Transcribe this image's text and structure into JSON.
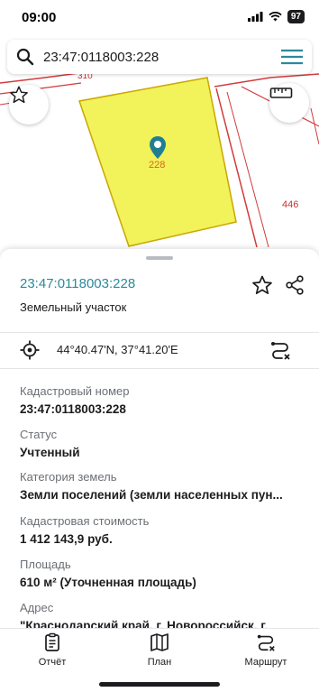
{
  "status_bar": {
    "time": "09:00",
    "battery": "97"
  },
  "search": {
    "query": "23:47:0118003:228"
  },
  "map": {
    "parcel_label": "228",
    "neighbor_label": "446",
    "partial_label": "310",
    "parcel_color": "#f2f25a",
    "boundary_color": "#d23b3b"
  },
  "card": {
    "title": "23:47:0118003:228",
    "subtitle": "Земельный участок",
    "coordinates": "44°40.47'N, 37°41.20'E",
    "accent_color": "#2b8a9b"
  },
  "fields": [
    {
      "label": "Кадастровый номер",
      "value": "23:47:0118003:228"
    },
    {
      "label": "Статус",
      "value": "Учтенный"
    },
    {
      "label": "Категория земель",
      "value": "Земли поселений (земли населенных пун..."
    },
    {
      "label": "Кадастровая стоимость",
      "value": "1 412 143,9 руб."
    },
    {
      "label": "Площадь",
      "value": "610 м² (Уточненная площадь)"
    },
    {
      "label": "Адрес",
      "value": "\"Краснодарский край, г. Новороссийск, г."
    }
  ],
  "tabs": [
    {
      "label": "Отчёт",
      "icon": "report-icon"
    },
    {
      "label": "План",
      "icon": "map-plan-icon"
    },
    {
      "label": "Маршрут",
      "icon": "route-icon"
    }
  ]
}
